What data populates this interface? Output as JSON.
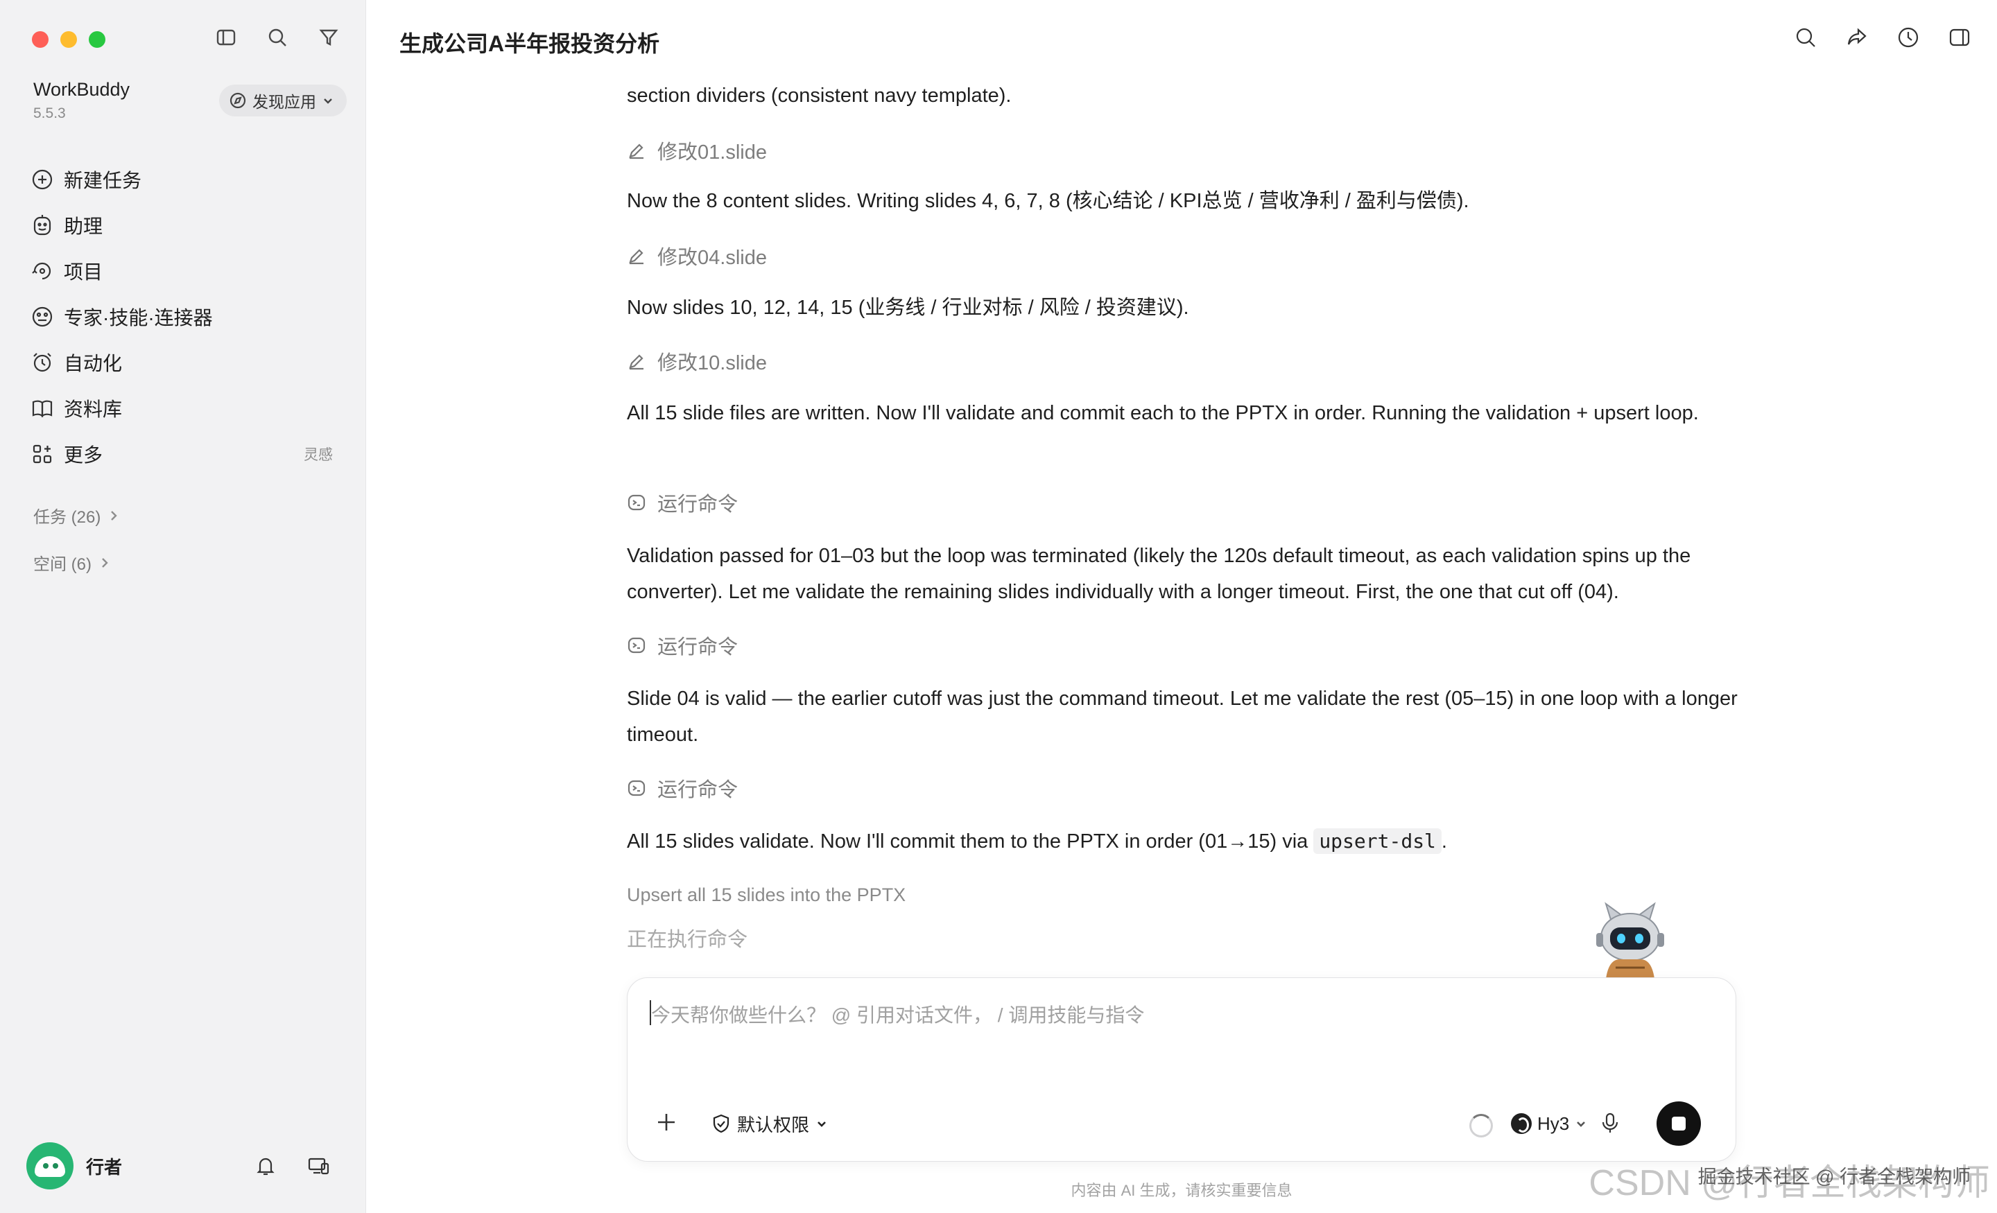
{
  "sidebar": {
    "app_name": "WorkBuddy",
    "app_version": "5.5.3",
    "discover_label": "发现应用",
    "nav": [
      {
        "label": "新建任务",
        "icon": "plus-circle-icon"
      },
      {
        "label": "助理",
        "icon": "assistant-icon"
      },
      {
        "label": "项目",
        "icon": "project-icon"
      },
      {
        "label": "专家·技能·连接器",
        "icon": "expert-icon"
      },
      {
        "label": "自动化",
        "icon": "alarm-icon"
      },
      {
        "label": "资料库",
        "icon": "book-icon"
      },
      {
        "label": "更多",
        "icon": "grid-plus-icon",
        "extra": "灵感"
      }
    ],
    "tasks_label": "任务 (26)",
    "spaces_label": "空间 (6)",
    "user_name": "行者"
  },
  "header": {
    "title": "生成公司A半年报投资分析"
  },
  "chat": {
    "p1": "section dividers (consistent navy template).",
    "a1": "修改01.slide",
    "p2": "Now the 8 content slides. Writing slides 4, 6, 7, 8 (核心结论 / KPI总览 / 营收净利 / 盈利与偿债).",
    "a2": "修改04.slide",
    "p3": "Now slides 10, 12, 14, 15 (业务线 / 行业对标 / 风险 / 投资建议).",
    "a3": "修改10.slide",
    "p4": "All 15 slide files are written. Now I'll validate and commit each to the PPTX in order. Running the validation + upsert loop.",
    "a4": "运行命令",
    "p5": "Validation passed for 01–03 but the loop was terminated (likely the 120s default timeout, as each validation spins up the converter). Let me validate the remaining slides individually with a longer timeout. First, the one that cut off (04).",
    "a5": "运行命令",
    "p6": "Slide 04 is valid — the earlier cutoff was just the command timeout. Let me validate the rest (05–15) in one loop with a longer timeout.",
    "a6": "运行命令",
    "p7_text": "All 15 slides validate. Now I'll commit them to the PPTX in order (01→15) via ",
    "p7_code": "upsert-dsl",
    "p7_tail": ".",
    "subtask": "Upsert all 15 slides into the PPTX",
    "running": "正在执行命令"
  },
  "composer": {
    "placeholder": "今天帮你做些什么？ @ 引用对话文件， / 调用技能与指令",
    "permission_label": "默认权限",
    "model_label": "Hy3"
  },
  "footer": {
    "disclaimer": "内容由 AI 生成，请核实重要信息",
    "watermark": "CSDN @行者全栈架构师",
    "watermark2": "掘金技术社区 @ 行者全栈架构师"
  }
}
